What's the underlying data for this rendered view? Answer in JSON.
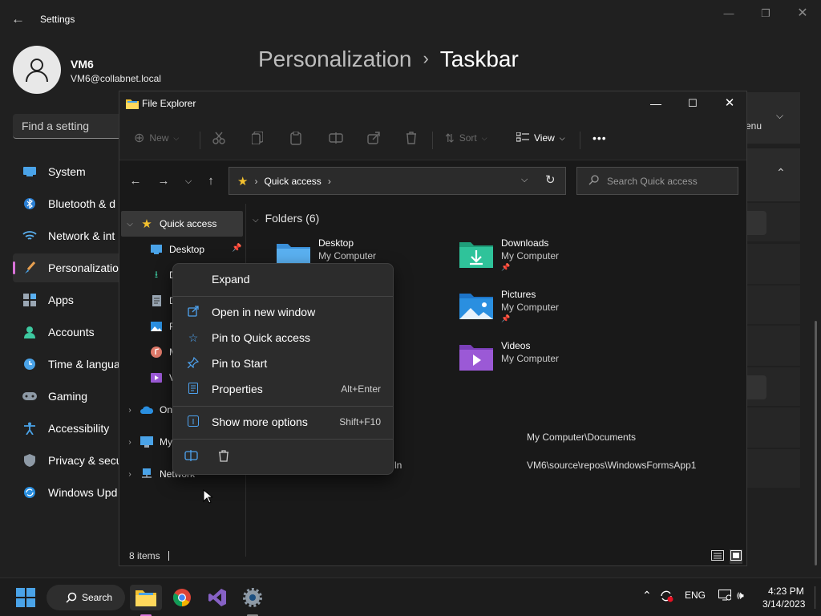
{
  "settings": {
    "title": "Settings",
    "user": {
      "name": "VM6",
      "email": "VM6@collabnet.local"
    },
    "find_placeholder": "Find a setting",
    "breadcrumb": {
      "parent": "Personalization",
      "current": "Taskbar"
    },
    "card_text": "enu",
    "nav": [
      {
        "label": "System",
        "icon": "system-icon"
      },
      {
        "label": "Bluetooth & d",
        "icon": "bluetooth-icon"
      },
      {
        "label": "Network & int",
        "icon": "wifi-icon"
      },
      {
        "label": "Personalization",
        "icon": "brush-icon",
        "active": true
      },
      {
        "label": "Apps",
        "icon": "apps-icon"
      },
      {
        "label": "Accounts",
        "icon": "accounts-icon"
      },
      {
        "label": "Time & langua",
        "icon": "clock-icon"
      },
      {
        "label": "Gaming",
        "icon": "gamepad-icon"
      },
      {
        "label": "Accessibility",
        "icon": "accessibility-icon"
      },
      {
        "label": "Privacy & secu",
        "icon": "shield-icon"
      },
      {
        "label": "Windows Upd",
        "icon": "update-icon"
      }
    ]
  },
  "explorer": {
    "title": "File Explorer",
    "toolbar": {
      "new": "New",
      "sort": "Sort",
      "view": "View",
      "more": "•••"
    },
    "address": "Quick access",
    "search_placeholder": "Search Quick access",
    "tree": {
      "quick_access": "Quick access",
      "desktop": "Desktop",
      "downloads": "D",
      "documents": "D",
      "pictures": "P",
      "music": "M",
      "videos": "V",
      "onedrive": "On",
      "mycomputer": "My",
      "network": "Network"
    },
    "folders_header": "Folders (6)",
    "folders": [
      {
        "name": "Desktop",
        "location": "My Computer"
      },
      {
        "name": "Downloads",
        "location": "My Computer"
      },
      {
        "name": "Pictures",
        "location": "My Computer"
      },
      {
        "name": "Videos",
        "location": "My Computer"
      }
    ],
    "recent": [
      {
        "name": "",
        "path": "My Computer\\Documents"
      },
      {
        "name": "ln",
        "path": "VM6\\source\\repos\\WindowsFormsApp1"
      }
    ],
    "status": "8 items"
  },
  "context_menu": {
    "expand": "Expand",
    "open_new_window": "Open in new window",
    "pin_quick": "Pin to Quick access",
    "pin_start": "Pin to Start",
    "properties": "Properties",
    "properties_shortcut": "Alt+Enter",
    "more_options": "Show more options",
    "more_options_shortcut": "Shift+F10"
  },
  "taskbar": {
    "search": "Search",
    "lang": "ENG",
    "time": "4:23 PM",
    "date": "3/14/2023"
  },
  "colors": {
    "accent": "#4ea3f0",
    "personalization_bar": "#d872d8",
    "folder_yellow": "#f4c12e"
  }
}
